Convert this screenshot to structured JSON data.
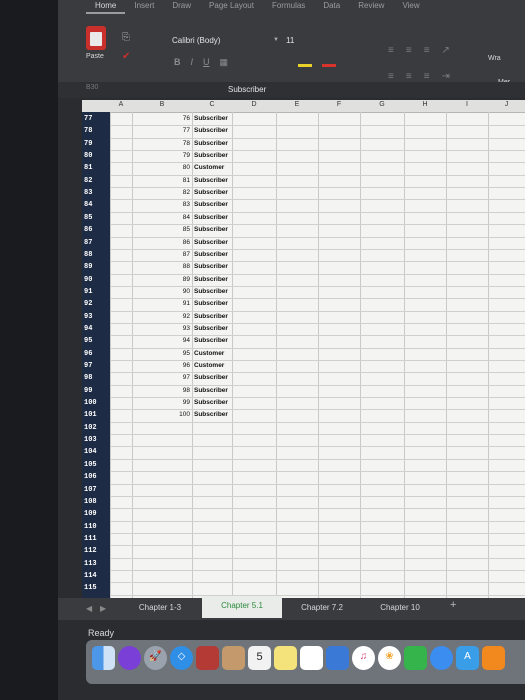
{
  "ribbon": {
    "tabs": [
      "Home",
      "Insert",
      "Draw",
      "Page Layout",
      "Formulas",
      "Data",
      "Review",
      "View"
    ],
    "paste_label": "Paste",
    "font_name": "Calibri (Body)",
    "font_size": "11",
    "format_buttons": [
      "B",
      "I",
      "U"
    ],
    "wrap_label": "Wra",
    "merge_label": "Mer"
  },
  "formula_bar": {
    "name_box": "B30",
    "value": "Subscriber"
  },
  "grid": {
    "columns": [
      "A",
      "B",
      "C",
      "D",
      "E",
      "F",
      "G",
      "H",
      "I",
      "J"
    ],
    "rows": [
      {
        "n": "77",
        "a": "76",
        "b": "Subscriber"
      },
      {
        "n": "78",
        "a": "77",
        "b": "Subscriber"
      },
      {
        "n": "79",
        "a": "78",
        "b": "Subscriber"
      },
      {
        "n": "80",
        "a": "79",
        "b": "Subscriber"
      },
      {
        "n": "81",
        "a": "80",
        "b": "Customer"
      },
      {
        "n": "82",
        "a": "81",
        "b": "Subscriber"
      },
      {
        "n": "83",
        "a": "82",
        "b": "Subscriber"
      },
      {
        "n": "84",
        "a": "83",
        "b": "Subscriber"
      },
      {
        "n": "85",
        "a": "84",
        "b": "Subscriber"
      },
      {
        "n": "86",
        "a": "85",
        "b": "Subscriber"
      },
      {
        "n": "87",
        "a": "86",
        "b": "Subscriber"
      },
      {
        "n": "88",
        "a": "87",
        "b": "Subscriber"
      },
      {
        "n": "89",
        "a": "88",
        "b": "Subscriber"
      },
      {
        "n": "90",
        "a": "89",
        "b": "Subscriber"
      },
      {
        "n": "91",
        "a": "90",
        "b": "Subscriber"
      },
      {
        "n": "92",
        "a": "91",
        "b": "Subscriber"
      },
      {
        "n": "93",
        "a": "92",
        "b": "Subscriber"
      },
      {
        "n": "94",
        "a": "93",
        "b": "Subscriber"
      },
      {
        "n": "95",
        "a": "94",
        "b": "Subscriber"
      },
      {
        "n": "96",
        "a": "95",
        "b": "Customer"
      },
      {
        "n": "97",
        "a": "96",
        "b": "Customer"
      },
      {
        "n": "98",
        "a": "97",
        "b": "Subscriber"
      },
      {
        "n": "99",
        "a": "98",
        "b": "Subscriber"
      },
      {
        "n": "100",
        "a": "99",
        "b": "Subscriber"
      },
      {
        "n": "101",
        "a": "100",
        "b": "Subscriber"
      },
      {
        "n": "102",
        "a": "",
        "b": ""
      },
      {
        "n": "103",
        "a": "",
        "b": ""
      },
      {
        "n": "104",
        "a": "",
        "b": ""
      },
      {
        "n": "105",
        "a": "",
        "b": ""
      },
      {
        "n": "106",
        "a": "",
        "b": ""
      },
      {
        "n": "107",
        "a": "",
        "b": ""
      },
      {
        "n": "108",
        "a": "",
        "b": ""
      },
      {
        "n": "109",
        "a": "",
        "b": ""
      },
      {
        "n": "110",
        "a": "",
        "b": ""
      },
      {
        "n": "111",
        "a": "",
        "b": ""
      },
      {
        "n": "112",
        "a": "",
        "b": ""
      },
      {
        "n": "113",
        "a": "",
        "b": ""
      },
      {
        "n": "114",
        "a": "",
        "b": ""
      },
      {
        "n": "115",
        "a": "",
        "b": ""
      }
    ]
  },
  "sheets": {
    "tabs": [
      "Chapter 1-3",
      "Chapter 5.1",
      "Chapter 7.2",
      "Chapter 10"
    ],
    "active": "Chapter 5.1",
    "add_label": "+"
  },
  "status": {
    "text": "Ready"
  },
  "dock": {
    "calendar_day": "5",
    "icons": [
      "finder-icon",
      "siri-icon",
      "launchpad-icon",
      "safari-icon",
      "mail-icon",
      "contacts-icon",
      "calendar-icon",
      "notes-icon",
      "reminders-icon",
      "keynote-icon",
      "itunes-icon",
      "photos-icon",
      "facetime-icon",
      "messages-icon",
      "app-store-icon",
      "ibooks-icon"
    ],
    "accent_colors": [
      "#c9302c",
      "#2e8b3d"
    ]
  }
}
